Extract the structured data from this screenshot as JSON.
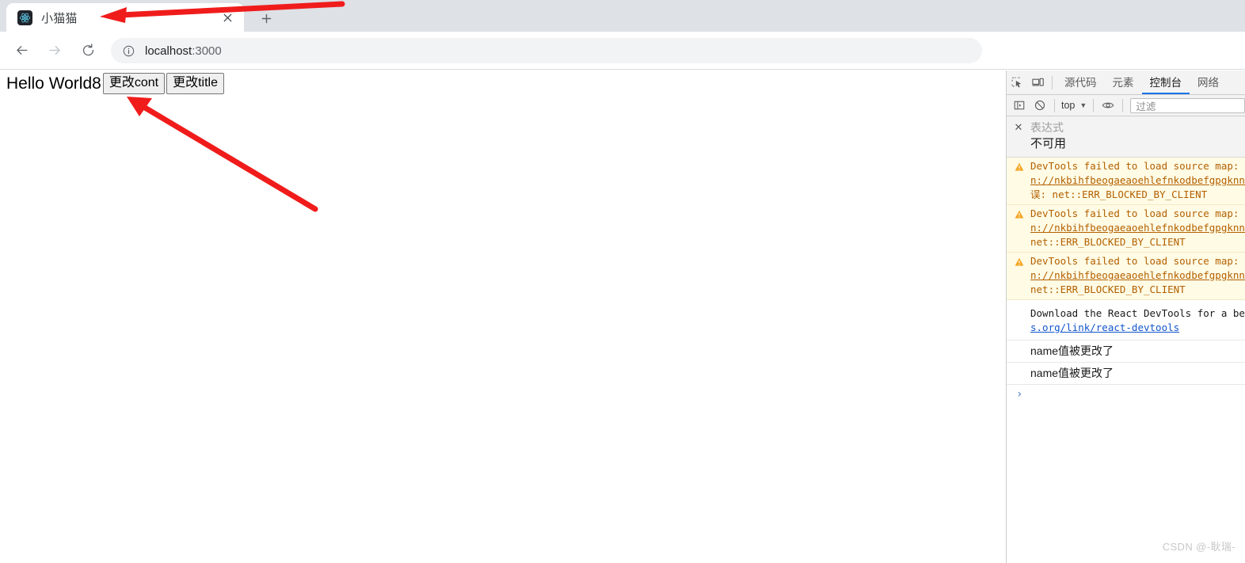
{
  "browser": {
    "tab": {
      "title": "小猫猫",
      "favicon_name": "react-logo-icon",
      "close_label": "✕"
    },
    "new_tab_label": "+",
    "nav": {
      "back_label": "←",
      "forward_label": "→",
      "reload_label": "⟳"
    },
    "omnibox": {
      "info_icon": "site-info-icon",
      "url_host": "localhost",
      "url_port": ":3000"
    }
  },
  "page": {
    "heading": "Hello World8",
    "buttons": [
      {
        "label": "更改cont",
        "name": "change-content-button"
      },
      {
        "label": "更改title",
        "name": "change-title-button"
      }
    ]
  },
  "devtools": {
    "tabs": [
      {
        "label": "源代码",
        "active": false
      },
      {
        "label": "元素",
        "active": false
      },
      {
        "label": "控制台",
        "active": true
      },
      {
        "label": "网络",
        "active": false
      }
    ],
    "toolbar": {
      "inspect_icon": "inspect-element-icon",
      "device_icon": "device-toolbar-icon",
      "sidebar_icon": "console-sidebar-icon",
      "clear_icon": "clear-console-icon",
      "context_value": "top",
      "context_caret": "▼",
      "eye_icon": "live-expression-eye-icon",
      "filter_placeholder": "过滤"
    },
    "live_expression": {
      "close_label": "✕",
      "placeholder": "表达式",
      "value": "不可用"
    },
    "messages": [
      {
        "type": "warning",
        "line1": "DevTools failed to load source map: C",
        "line2": "n://nkbihfbeogaeaoehlefnkodbefgpgknn/",
        "line3": "误: net::ERR_BLOCKED_BY_CLIENT"
      },
      {
        "type": "warning",
        "line1": "DevTools failed to load source map: C",
        "line2": "n://nkbihfbeogaeaoehlefnkodbefgpgknn/",
        "line3": "net::ERR_BLOCKED_BY_CLIENT"
      },
      {
        "type": "warning",
        "line1": "DevTools failed to load source map: C",
        "line2": "n://nkbihfbeogaeaoehlefnkodbefgpgknn/",
        "line3": "net::ERR_BLOCKED_BY_CLIENT"
      },
      {
        "type": "info",
        "line1": "Download the React DevTools for a bet",
        "line2": "s.org/link/react-devtools"
      },
      {
        "type": "log",
        "text": "name值被更改了"
      },
      {
        "type": "log",
        "text": "name值被更改了"
      }
    ],
    "prompt_caret": "›"
  },
  "annotations": {
    "arrow_color": "#f01c1c",
    "arrow_tab_name": "arrow-pointing-to-tab-title",
    "arrow_button_name": "arrow-pointing-to-change-content-button"
  },
  "watermark": "CSDN @-耿瑞-",
  "colors": {
    "chrome_bg": "#dee1e6",
    "accent_tab_underline": "#1a73e8",
    "warning_bg": "#fffbe5",
    "warning_text": "#b36000",
    "link": "#1155cc"
  }
}
